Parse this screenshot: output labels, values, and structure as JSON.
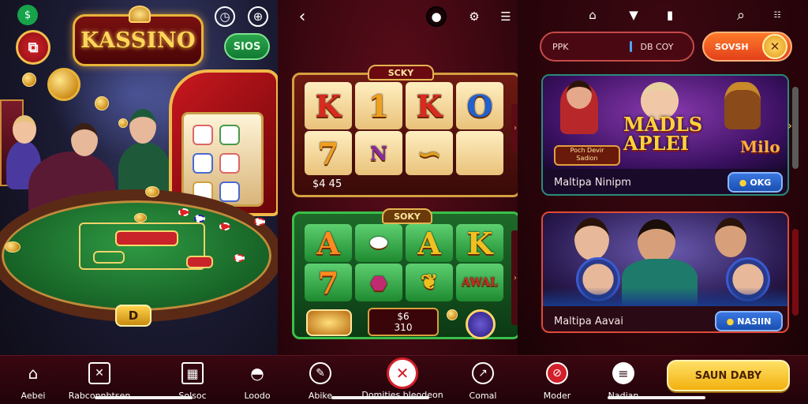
{
  "panel1": {
    "logo": "KASSINO",
    "top_pill": "SIOS",
    "table_button": "D"
  },
  "panel2": {
    "card1": {
      "title": "SCKY",
      "symbols": [
        "K",
        "1",
        "K",
        "O",
        "7",
        "N",
        "",
        ""
      ],
      "value": "$4 45"
    },
    "card2": {
      "title": "SOKY",
      "symbols": [
        "A",
        "",
        "A",
        "K",
        "7",
        "",
        "",
        "AWAL"
      ],
      "value_line1": "$6",
      "value_line2": "310"
    }
  },
  "panel3": {
    "search": {
      "left": "PPK",
      "right": "DB COY"
    },
    "orange_pill": "SOVSH",
    "cards": [
      {
        "art_title": "MADLS\nAPLEI",
        "art_sub": "Poch Devir\nSadion",
        "art_sub2": "Milo",
        "label": "Maltipa Ninipm",
        "button": "OKG"
      },
      {
        "label": "Maltipa Aavai",
        "button": "NASIIN"
      }
    ]
  },
  "bottom_nav": {
    "items": [
      {
        "label": "Aebei",
        "icon": "home-icon"
      },
      {
        "label": "Rabconnbtsen",
        "icon": "cross-icon"
      },
      {
        "label": "Solsoc",
        "icon": "grid-icon"
      },
      {
        "label": "Loodo",
        "icon": "wifi-icon"
      },
      {
        "label": "Abike",
        "icon": "compass-icon"
      },
      {
        "label": "Domities bleodeon",
        "icon": "close-circle-icon"
      },
      {
        "label": "Comal",
        "icon": "chart-icon"
      },
      {
        "label": "Moder",
        "icon": "no-icon"
      },
      {
        "label": "Nadian",
        "icon": "menu-icon"
      }
    ],
    "cta": "SAUN DABY"
  },
  "colors": {
    "accent_gold": "#f2b10e",
    "brand_red": "#c8181f",
    "nav_bg": "#3a0710"
  }
}
